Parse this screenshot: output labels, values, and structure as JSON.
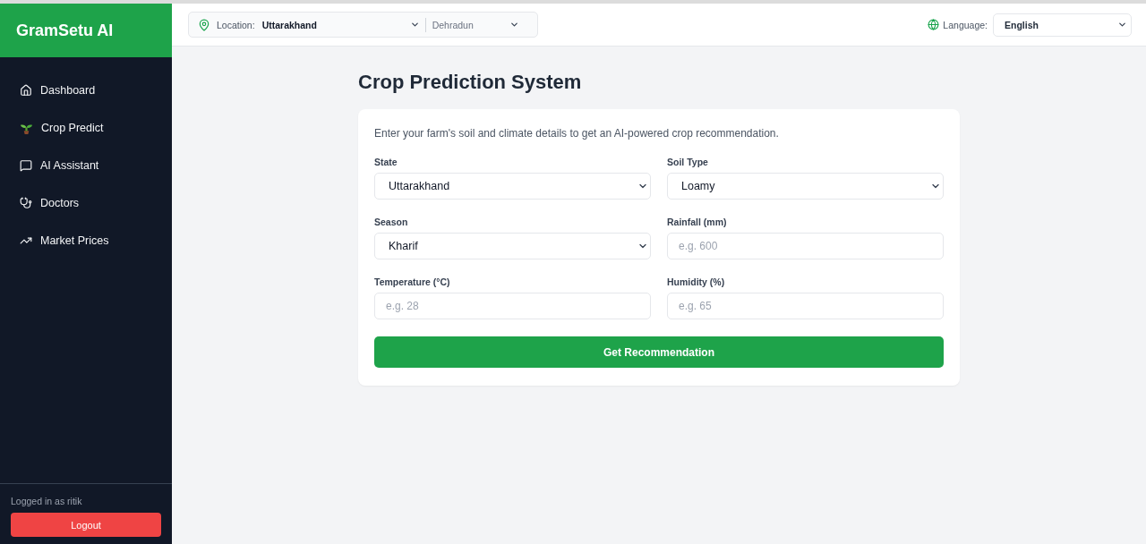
{
  "sidebar": {
    "brand": "GramSetu AI",
    "nav": [
      {
        "label": "Dashboard"
      },
      {
        "label": "Crop Predict"
      },
      {
        "label": "AI Assistant"
      },
      {
        "label": "Doctors"
      },
      {
        "label": "Market Prices"
      }
    ],
    "user_text": "Logged in as ritik",
    "logout": "Logout"
  },
  "topbar": {
    "location_label": "Location:",
    "state": "Uttarakhand",
    "district": "Dehradun",
    "language_label": "Language:",
    "language": "English"
  },
  "page": {
    "title": "Crop Prediction System",
    "description": "Enter your farm's soil and climate details to get an AI-powered crop recommendation.",
    "fields": [
      {
        "kind": "select",
        "label": "State",
        "value": "Uttarakhand"
      },
      {
        "kind": "select",
        "label": "Soil Type",
        "value": "Loamy"
      },
      {
        "kind": "select",
        "label": "Season",
        "value": "Kharif"
      },
      {
        "kind": "input",
        "label": "Rainfall (mm)",
        "placeholder": "e.g. 600"
      },
      {
        "kind": "input",
        "label": "Temperature (°C)",
        "placeholder": "e.g. 28"
      },
      {
        "kind": "input",
        "label": "Humidity (%)",
        "placeholder": "e.g. 65"
      }
    ],
    "submit": "Get Recommendation"
  }
}
